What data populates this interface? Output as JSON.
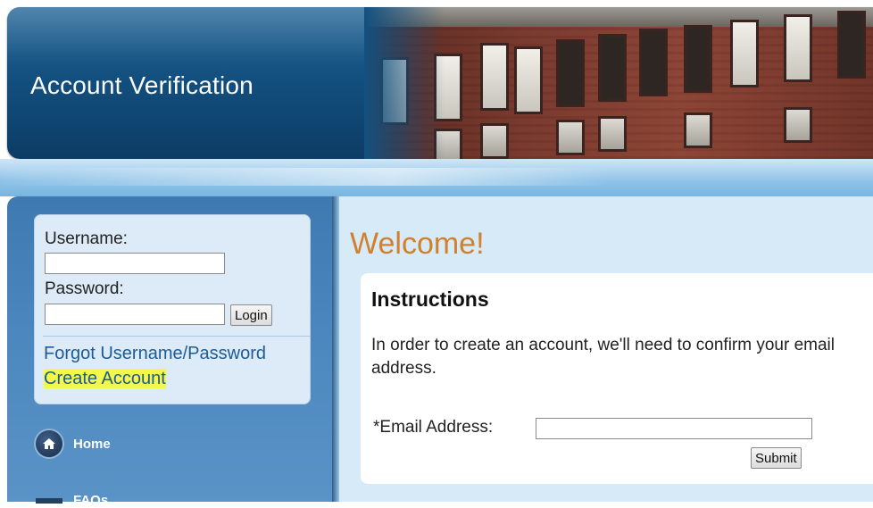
{
  "header": {
    "title": "Account Verification"
  },
  "login": {
    "username_label": "Username:",
    "username_value": "",
    "password_label": "Password:",
    "password_value": "",
    "login_button": "Login",
    "forgot_link": "Forgot Username/Password",
    "create_link": "Create Account"
  },
  "nav": {
    "items": [
      {
        "label": "Home",
        "icon": "home-icon"
      },
      {
        "label": "FAQs",
        "icon": "faq-icon"
      }
    ]
  },
  "main": {
    "welcome": "Welcome!",
    "instructions_title": "Instructions",
    "instructions_text": "In order to create an account, we'll need to confirm your email address.",
    "email_label": "*Email Address:",
    "email_value": "",
    "submit_button": "Submit"
  },
  "colors": {
    "header_blue": "#13507f",
    "welcome_orange": "#d0812f",
    "link_blue": "#1e5b94",
    "highlight_yellow": "#f4f84a"
  }
}
